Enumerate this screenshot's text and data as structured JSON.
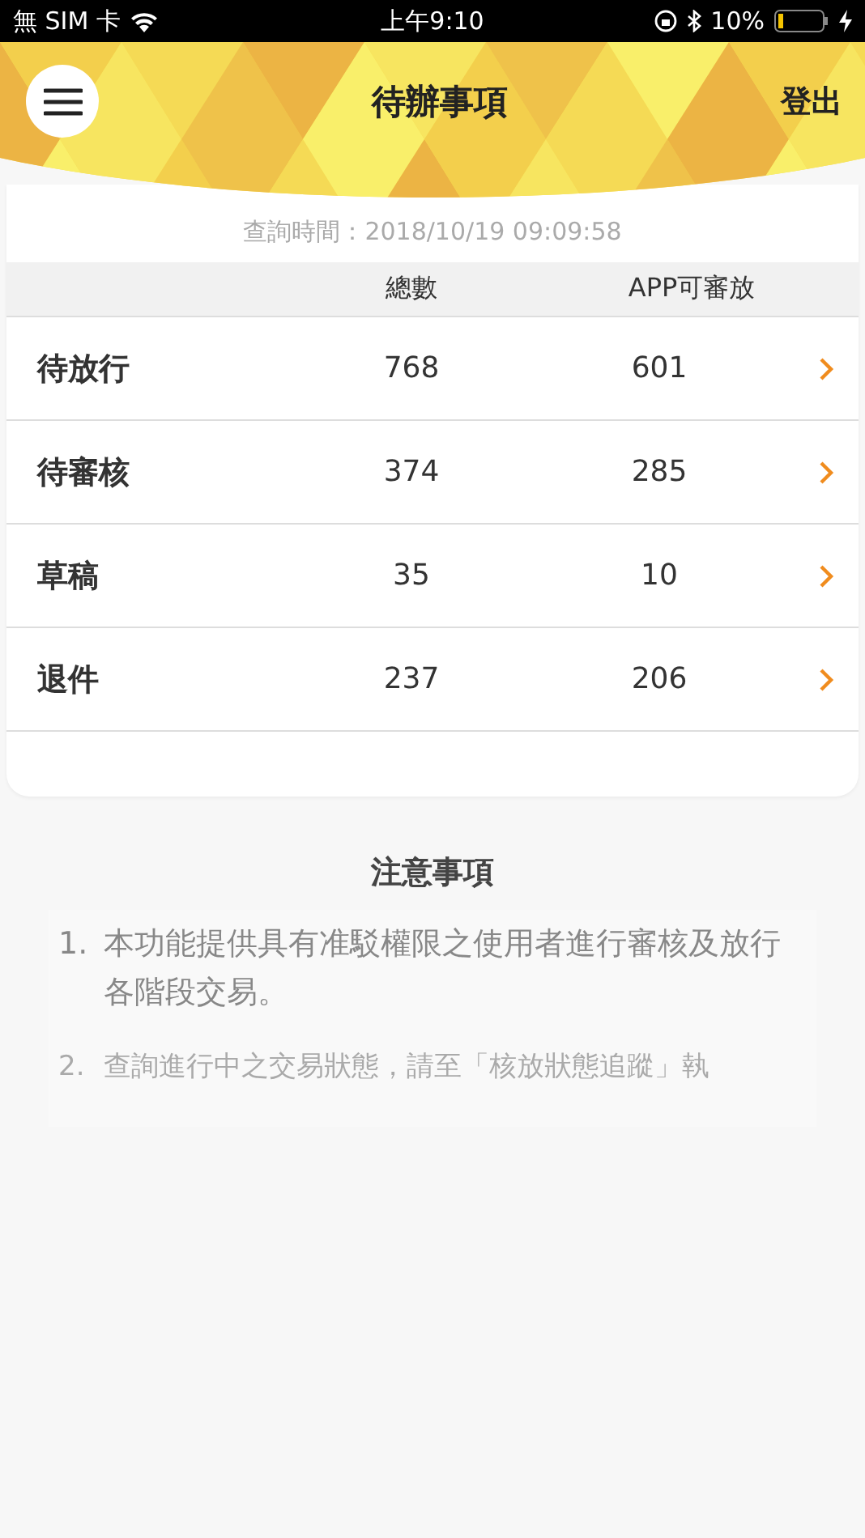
{
  "status_bar": {
    "carrier": "無 SIM 卡",
    "time": "上午9:10",
    "battery": "10%"
  },
  "header": {
    "title": "待辦事項",
    "logout": "登出"
  },
  "query_time": "查詢時間：2018/10/19 09:09:58",
  "table": {
    "columns": [
      "總數",
      "APP可審放"
    ],
    "rows": [
      {
        "label": "待放行",
        "total": "768",
        "app": "601"
      },
      {
        "label": "待審核",
        "total": "374",
        "app": "285"
      },
      {
        "label": "草稿",
        "total": "35",
        "app": "10"
      },
      {
        "label": "退件",
        "total": "237",
        "app": "206"
      }
    ]
  },
  "notes": {
    "title": "注意事項",
    "items": [
      {
        "number": "1.",
        "text": "本功能提供具有准駁權限之使用者進行審核及放行各階段交易。"
      },
      {
        "number": "2.",
        "text": "查詢進行中之交易狀態，請至「核放狀態追蹤」執"
      }
    ]
  }
}
